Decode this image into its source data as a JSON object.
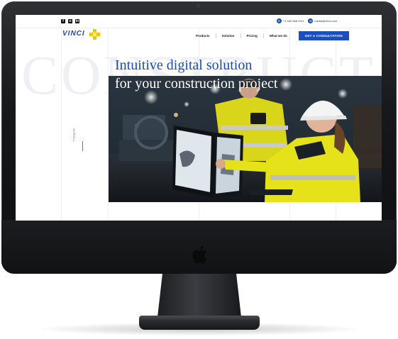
{
  "header": {
    "social_icons": [
      "facebook-icon",
      "instagram-icon",
      "linkedin-icon"
    ],
    "phone": "+1 402 988 9111",
    "email": "media@vinci.com"
  },
  "logo": {
    "text": "VINCI"
  },
  "nav": {
    "items": [
      {
        "label": "Products"
      },
      {
        "label": "Solution"
      },
      {
        "label": "Pricing"
      },
      {
        "label": "What we do"
      }
    ],
    "cta_label": "GET A CONSULTATION"
  },
  "hero": {
    "watermark": "CONSTRUCT",
    "headline_line1": "Intuitive digital solution",
    "headline_line2": "for your construction project",
    "scroll_label": "SCROLL"
  },
  "colors": {
    "brand_blue": "#1c4ea6",
    "cta_blue": "#1d4ec0",
    "logo_yellow": "#f2c500",
    "hivis_yellow": "#e6e21a"
  }
}
